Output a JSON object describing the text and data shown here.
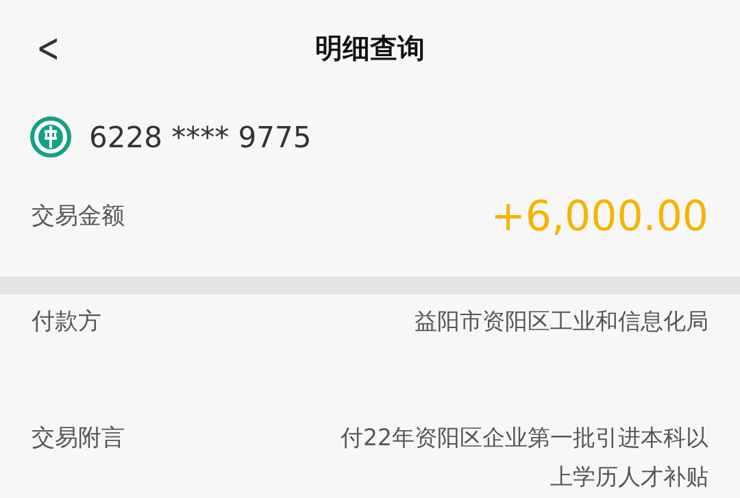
{
  "header": {
    "back": "<",
    "title": "明细查询"
  },
  "account": {
    "card_number": "6228 **** 9775"
  },
  "amount": {
    "label": "交易金额",
    "value": "+6,000.00"
  },
  "details": [
    {
      "label": "付款方",
      "value": "益阳市资阳区工业和信息化局"
    },
    {
      "label": "交易附言",
      "value": "付22年资阳区企业第一批引进本科以上学历人才补贴"
    }
  ]
}
